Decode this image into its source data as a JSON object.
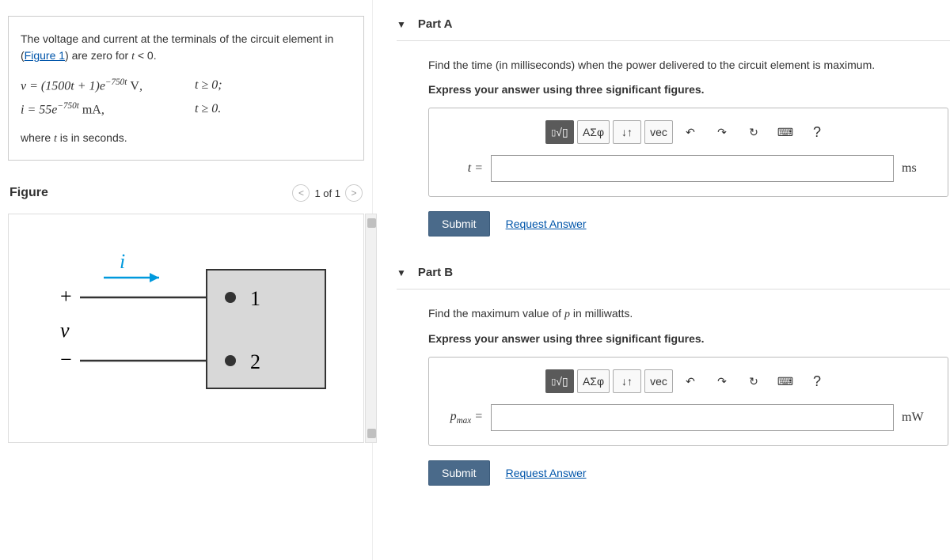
{
  "problem": {
    "intro_pre": "The voltage and current at the terminals of the circuit element in (",
    "figure_link": "Figure 1",
    "intro_post": ") are zero for t < 0.",
    "eq_v": "v = (1500t + 1)e⁻⁷⁵⁰ᵗ V,",
    "eq_v_cond": "t ≥ 0;",
    "eq_i": "i = 55e⁻⁷⁵⁰ᵗ mA,",
    "eq_i_cond": "t ≥ 0.",
    "where": "where t is in seconds."
  },
  "figure": {
    "title": "Figure",
    "pager": "1 of 1",
    "label_i": "i",
    "label_plus": "+",
    "label_v": "v",
    "label_minus": "−",
    "node1": "1",
    "node2": "2"
  },
  "partA": {
    "title": "Part A",
    "question": "Find the time (in milliseconds) when the power delivered to the circuit element is maximum.",
    "instruction": "Express your answer using three significant figures.",
    "var": "t =",
    "unit": "ms",
    "value": ""
  },
  "partB": {
    "title": "Part B",
    "question_pre": "Find the maximum value of ",
    "question_var": "p",
    "question_post": " in milliwatts.",
    "instruction": "Express your answer using three significant figures.",
    "var": "pmax =",
    "unit": "mW",
    "value": ""
  },
  "toolbar": {
    "templates": "▢√▢",
    "greek": "ΑΣφ",
    "subscript": "↓↑",
    "vec": "vec",
    "undo": "↶",
    "redo": "↷",
    "reset": "↻",
    "keyboard": "⌨",
    "help": "?"
  },
  "buttons": {
    "submit": "Submit",
    "request": "Request Answer"
  }
}
